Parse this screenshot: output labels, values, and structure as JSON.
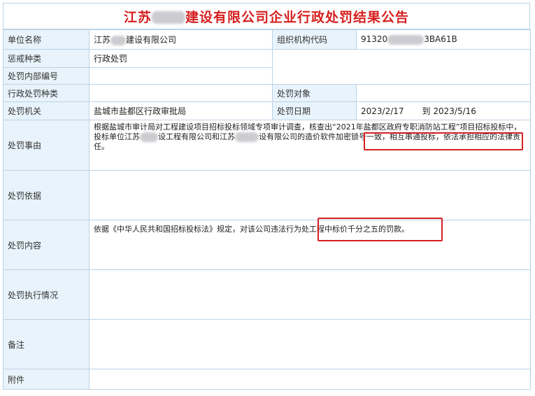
{
  "title": {
    "prefix": "江苏",
    "suffix": "建设有限公司企业行政处罚结果公告"
  },
  "fields": {
    "unit_name": {
      "label": "单位名称",
      "value_prefix": "江苏",
      "value_suffix": "建设有限公司"
    },
    "org_code": {
      "label": "组织机构代码",
      "value_prefix": "91320",
      "value_suffix": "3BA61B"
    },
    "penalty_type": {
      "label": "惩戒种类",
      "value": "行政处罚"
    },
    "internal_no": {
      "label": "处罚内部编号",
      "value": ""
    },
    "admin_penalty_type": {
      "label": "行政处罚种类",
      "value": ""
    },
    "penalty_target": {
      "label": "处罚对象",
      "value": ""
    },
    "authority": {
      "label": "处罚机关",
      "value": "盐城市盐都区行政审批局"
    },
    "date": {
      "label": "处罚日期",
      "from": "2023/2/17",
      "to_prefix": "到",
      "to": "2023/5/16"
    },
    "reason": {
      "label": "处罚事由",
      "part1": "根据盐城市审计局对工程建设项目招标投标领域专项审计调查，核查出“2021年盐都区政府专职消防站工程”项目招标投标中，投标单位江苏",
      "part2": "设工程有限公司和江苏",
      "part3": "设有限公司的",
      "highlight": "造价软件加密锁号一致，相互串通投标，",
      "part4": "依法承担相应的法律责任。"
    },
    "basis": {
      "label": "处罚依据",
      "value": ""
    },
    "content": {
      "label": "处罚内容",
      "part1": "依据《中华人民共和国招标投标法》规定，对该公司违法行为",
      "highlight": "处工程中标价千分之五的罚款。"
    },
    "execution": {
      "label": "处罚执行情况",
      "value": ""
    },
    "remark": {
      "label": "备注",
      "value": ""
    },
    "attachment": {
      "label": "附件",
      "value": ""
    }
  }
}
